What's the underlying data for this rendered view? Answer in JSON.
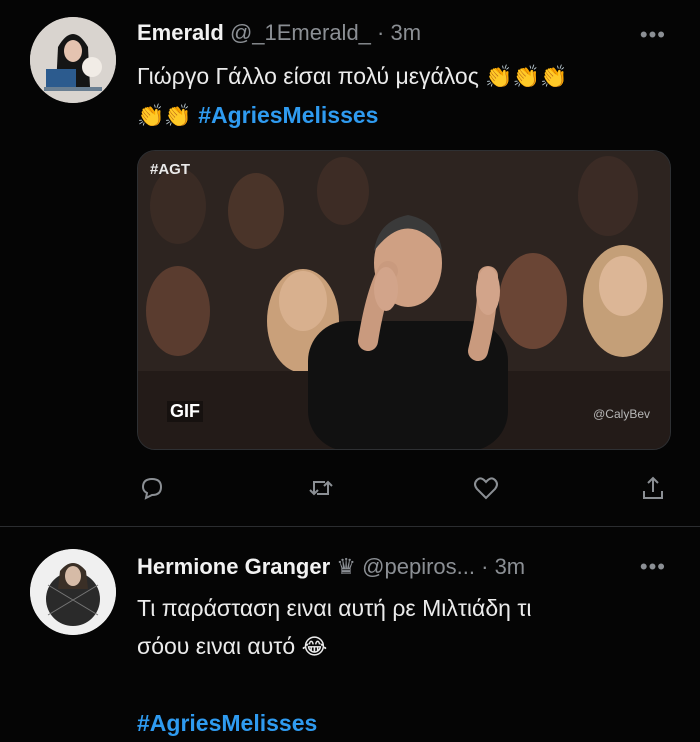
{
  "tweets": [
    {
      "name": "Emerald",
      "handle": "@_1Emerald_",
      "dot": "·",
      "time": "3m",
      "more": "•••",
      "text": "Γιώργο Γάλλο είσαι πολύ μεγάλος",
      "emoji_line1": "👏👏👏",
      "emoji_line2": "👏👏",
      "hashtag": "#AgriesMelisses",
      "media": {
        "top_left_badge": "#AGT",
        "gif_badge": "GIF",
        "watermark": "@CalyBev"
      },
      "actions": [
        "reply-icon",
        "retweet-icon",
        "like-icon",
        "share-icon"
      ]
    },
    {
      "name": "Hermione Granger",
      "crown": "♛",
      "handle": "@pepiros...",
      "dot": "·",
      "time": "3m",
      "more": "•••",
      "text_line1": "Τι παράσταση ειναι αυτή ρε Μιλτιάδη τι",
      "text_line2": "σόου ειναι αυτό",
      "emoji": "😂",
      "hashtag": "#AgriesMelisses"
    }
  ],
  "colors": {
    "background": "#050505",
    "hashtag": "#2f9bf0",
    "muted": "#8b8f94"
  }
}
